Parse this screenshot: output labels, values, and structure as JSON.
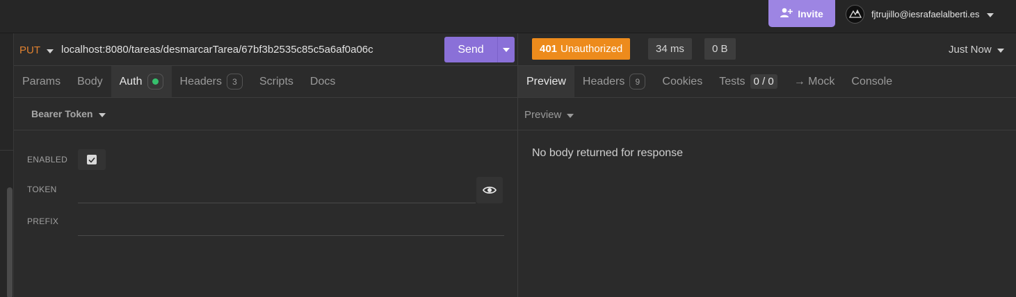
{
  "header": {
    "invite_label": "Invite",
    "user_email": "fjtrujillo@iesrafaelalberti.es",
    "colors": {
      "invite_bg": "#9d85e3"
    }
  },
  "request": {
    "method": "PUT",
    "url": "localhost:8080/tareas/desmarcarTarea/67bf3b2535c85c5a6af0a06c",
    "send_label": "Send",
    "tabs": [
      {
        "label": "Params"
      },
      {
        "label": "Body"
      },
      {
        "label": "Auth"
      },
      {
        "label": "Headers",
        "badge": "3"
      },
      {
        "label": "Scripts"
      },
      {
        "label": "Docs"
      }
    ],
    "active_tab": "Auth",
    "auth": {
      "type": "Bearer Token",
      "enabled_label": "ENABLED",
      "enabled": true,
      "token_label": "TOKEN",
      "token_value": "",
      "prefix_label": "PREFIX",
      "prefix_value": ""
    },
    "colors": {
      "method": "#e0812f",
      "send_bg": "#8a70d8",
      "auth_dot": "#36c06d"
    }
  },
  "response": {
    "status_code": "401",
    "status_text": "Unauthorized",
    "time": "34 ms",
    "size": "0 B",
    "history_label": "Just Now",
    "tabs": [
      {
        "label": "Preview"
      },
      {
        "label": "Headers",
        "badge": "9"
      },
      {
        "label": "Cookies"
      },
      {
        "label": "Tests",
        "badge": "0 / 0"
      },
      {
        "label": "→ Mock"
      },
      {
        "label": "Console"
      }
    ],
    "active_tab": "Preview",
    "preview_mode": "Preview",
    "body_message": "No body returned for response",
    "colors": {
      "status_bg": "#ed8b1c"
    }
  }
}
